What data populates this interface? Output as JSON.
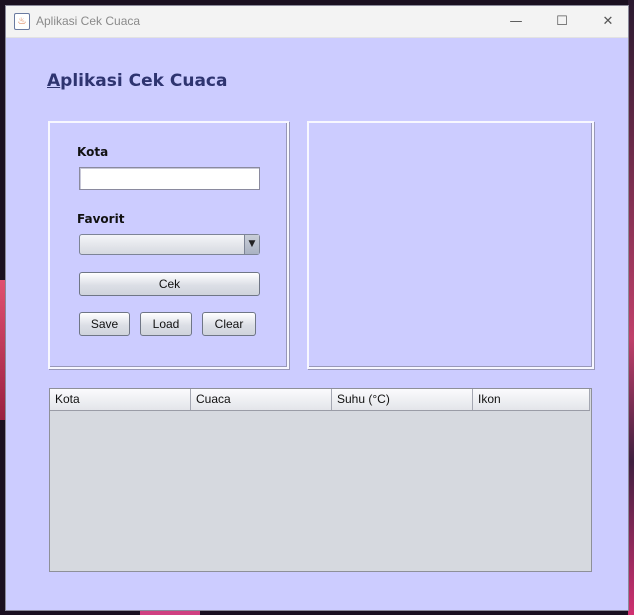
{
  "window": {
    "title": "Aplikasi Cek Cuaca",
    "icon": "java-icon",
    "controls": {
      "minimize": "—",
      "maximize": "☐",
      "close": "✕"
    }
  },
  "heading": {
    "mnemonic": "A",
    "rest": "plikasi Cek Cuaca"
  },
  "form": {
    "kota_label": "Kota",
    "kota_value": "",
    "favorit_label": "Favorit",
    "favorit_selected": "",
    "cek_button": "Cek",
    "save_button": "Save",
    "load_button": "Load",
    "clear_button": "Clear"
  },
  "table": {
    "columns": [
      "Kota",
      "Cuaca",
      "Suhu (°C)",
      "Ikon"
    ],
    "rows": []
  },
  "colors": {
    "background": "#ccccff",
    "heading": "#2e3470"
  }
}
